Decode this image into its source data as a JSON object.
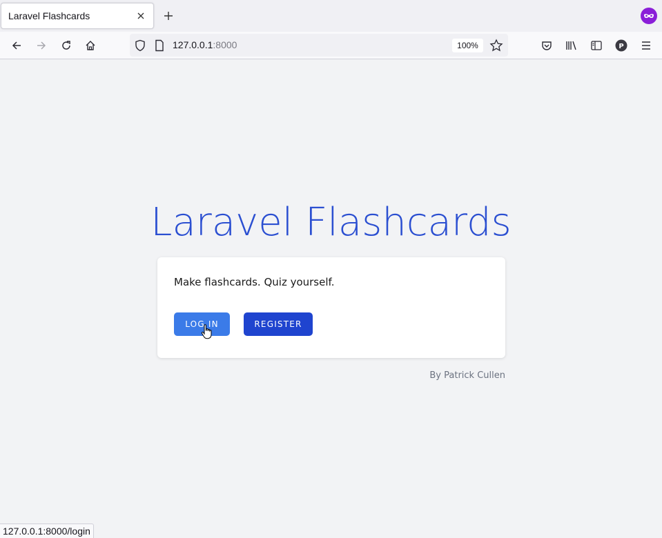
{
  "browser": {
    "tab_title": "Laravel Flashcards",
    "url_host": "127.0.0.1",
    "url_port": ":8000",
    "zoom": "100%",
    "status_url": "127.0.0.1:8000/login"
  },
  "icons": [
    "close-icon",
    "plus-icon",
    "mask-icon",
    "back-arrow-icon",
    "forward-arrow-icon",
    "reload-icon",
    "home-icon",
    "shield-icon",
    "page-icon",
    "star-icon",
    "pocket-icon",
    "library-icon",
    "sidebar-icon",
    "profile-icon",
    "menu-icon",
    "hand-cursor-icon"
  ],
  "page": {
    "title": "Laravel Flashcards",
    "tagline": "Make flashcards. Quiz yourself.",
    "login_label": "LOG IN",
    "register_label": "REGISTER",
    "byline": "By Patrick Cullen",
    "avatar_letter": "P"
  },
  "colors": {
    "title": "#2b4fd1",
    "login_button": "#3b7be8",
    "register_button": "#1f44cf",
    "background": "#f2f3f5"
  }
}
